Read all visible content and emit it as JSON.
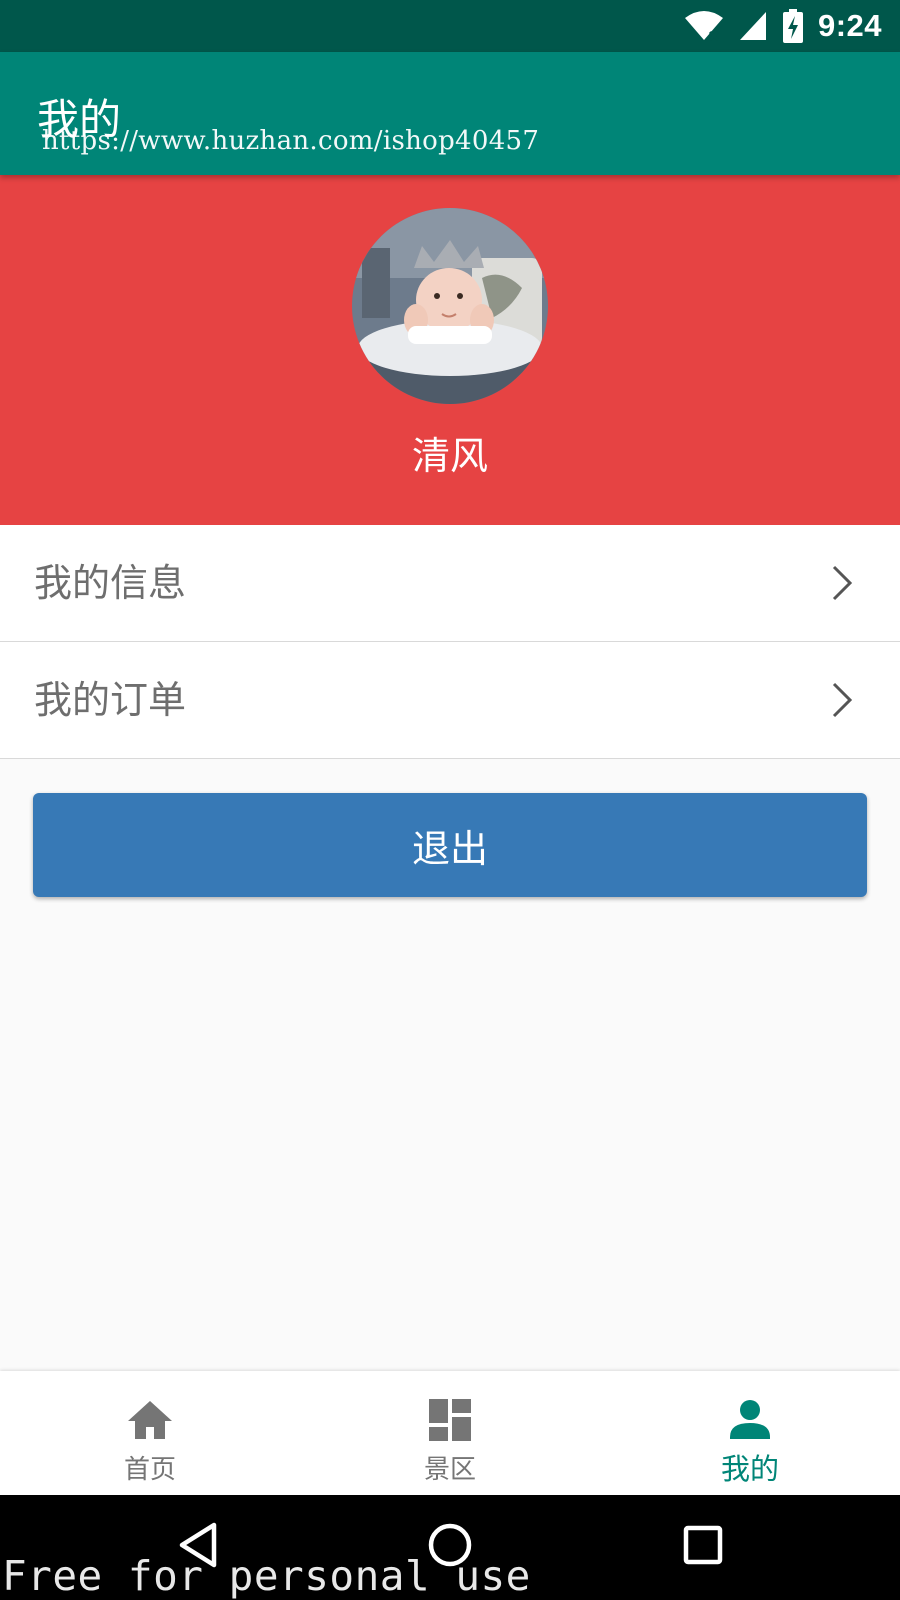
{
  "status_bar": {
    "time": "9:24",
    "icons": [
      "wifi-icon",
      "cellular-signal-icon",
      "battery-charging-icon"
    ]
  },
  "app_bar": {
    "title": "我的",
    "watermark_url": "https://www.huzhan.com/ishop40457"
  },
  "profile": {
    "username": "清风",
    "header_color": "#e64343"
  },
  "menu": {
    "items": [
      {
        "label": "我的信息",
        "icon": "chevron-right-icon"
      },
      {
        "label": "我的订单",
        "icon": "chevron-right-icon"
      }
    ]
  },
  "logout": {
    "label": "退出",
    "color": "#3779b6"
  },
  "bottom_nav": {
    "items": [
      {
        "label": "首页",
        "icon": "home-icon",
        "active": false
      },
      {
        "label": "景区",
        "icon": "dashboard-icon",
        "active": false
      },
      {
        "label": "我的",
        "icon": "person-icon",
        "active": true
      }
    ],
    "active_color": "#008577"
  },
  "system_nav": {
    "buttons": [
      "back-icon",
      "home-circle-icon",
      "recents-icon"
    ]
  },
  "watermark_footer": "Free for personal use",
  "colors": {
    "primary": "#008577",
    "primary_dark": "#00574b"
  }
}
